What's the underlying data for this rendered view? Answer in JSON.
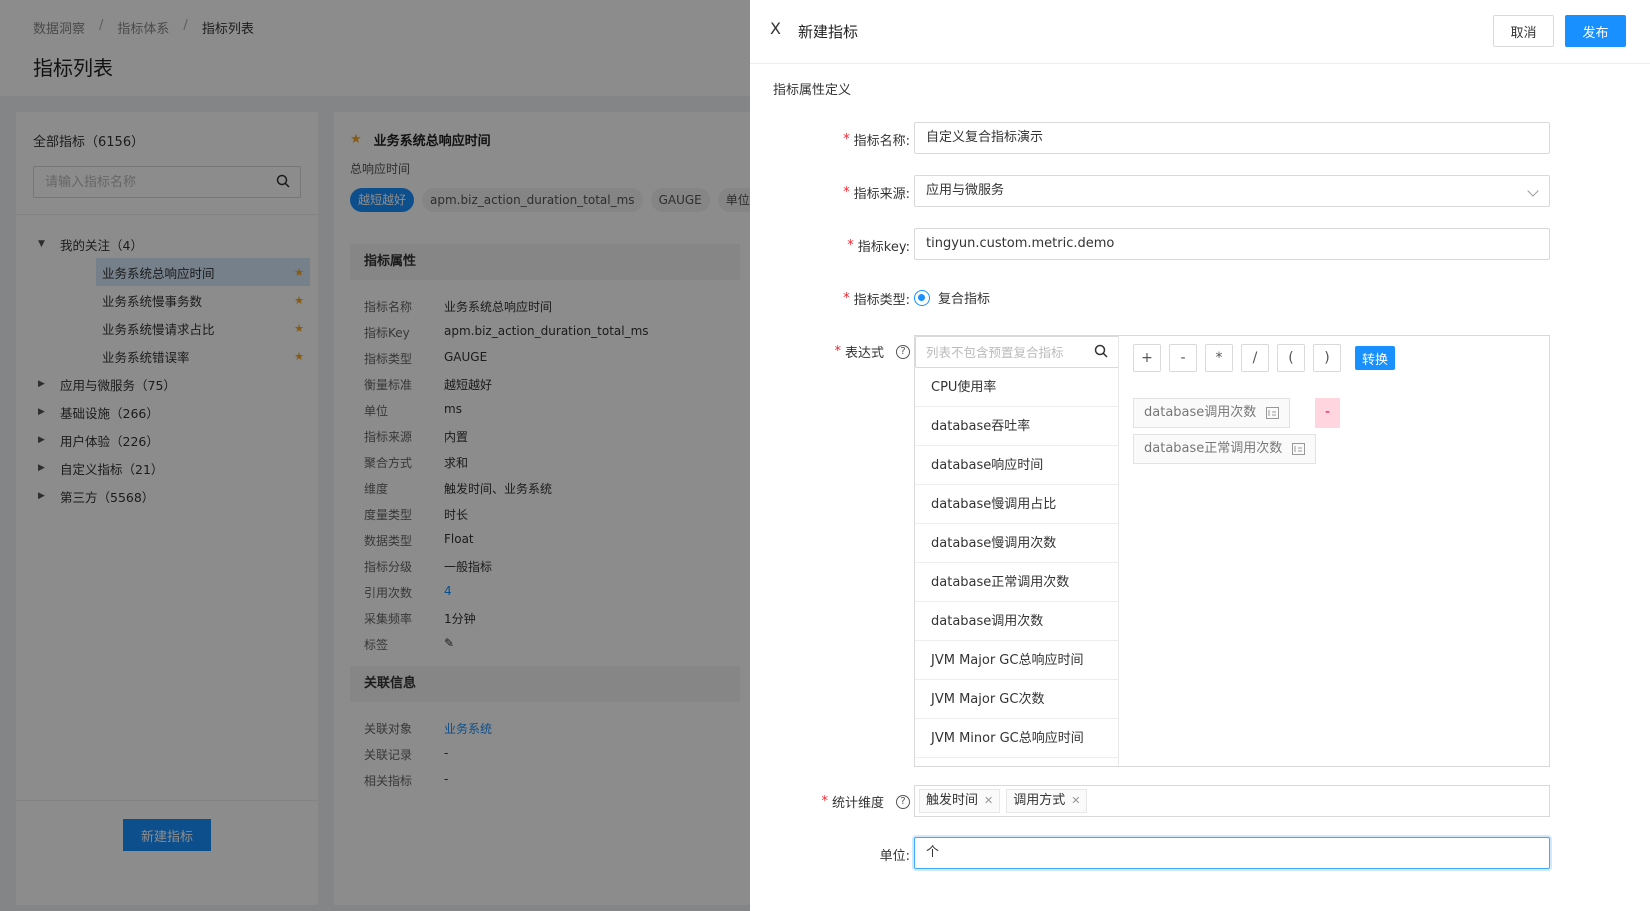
{
  "background": {
    "breadcrumb": [
      "数据洞察",
      "指标体系",
      "指标列表"
    ],
    "page_title": "指标列表",
    "left": {
      "total": "全部指标（6156）",
      "search_placeholder": "请输入指标名称",
      "groups": [
        {
          "label": "我的关注（4）",
          "expanded": true,
          "children": [
            "业务系统总响应时间",
            "业务系统慢事务数",
            "业务系统慢请求占比",
            "业务系统错误率"
          ]
        },
        {
          "label": "应用与微服务（75）"
        },
        {
          "label": "基础设施（266）"
        },
        {
          "label": "用户体验（226）"
        },
        {
          "label": "自定义指标（21）"
        },
        {
          "label": "第三方（5568）"
        }
      ],
      "new_button": "新建指标"
    },
    "mid": {
      "title": "业务系统总响应时间",
      "subtitle": "总响应时间",
      "tags": [
        "越短越好",
        "apm.biz_action_duration_total_ms",
        "GAUGE",
        "单位：ms"
      ],
      "attr_section": "指标属性",
      "attrs": [
        {
          "k": "指标名称",
          "v": "业务系统总响应时间"
        },
        {
          "k": "指标Key",
          "v": "apm.biz_action_duration_total_ms"
        },
        {
          "k": "指标类型",
          "v": "GAUGE"
        },
        {
          "k": "衡量标准",
          "v": "越短越好"
        },
        {
          "k": "单位",
          "v": "ms"
        },
        {
          "k": "指标来源",
          "v": "内置"
        },
        {
          "k": "聚合方式",
          "v": "求和"
        },
        {
          "k": "维度",
          "v": "触发时间、业务系统"
        },
        {
          "k": "度量类型",
          "v": "时长"
        },
        {
          "k": "数据类型",
          "v": "Float"
        },
        {
          "k": "指标分级",
          "v": "一般指标"
        },
        {
          "k": "引用次数",
          "v": "4"
        },
        {
          "k": "采集频率",
          "v": "1分钟"
        },
        {
          "k": "标签",
          "v": "✎"
        }
      ],
      "rel_section": "关联信息",
      "rels": [
        {
          "k": "关联对象",
          "v": "业务系统"
        },
        {
          "k": "关联记录",
          "v": "-"
        },
        {
          "k": "相关指标",
          "v": "-"
        }
      ]
    }
  },
  "drawer": {
    "close": "X",
    "title": "新建指标",
    "cancel": "取消",
    "publish": "发布",
    "section": "指标属性定义",
    "fields": {
      "name": {
        "label": "指标名称:",
        "value": "自定义复合指标演示"
      },
      "source": {
        "label": "指标来源:",
        "value": "应用与微服务"
      },
      "key": {
        "label": "指标key:",
        "value": "tingyun.custom.metric.demo"
      },
      "type": {
        "label": "指标类型:",
        "value": "复合指标"
      },
      "expr": {
        "label": "表达式",
        "search_placeholder": "列表不包含预置复合指标"
      },
      "dims": {
        "label": "统计维度"
      },
      "unit": {
        "label": "单位:",
        "value": "个"
      }
    },
    "metric_list": [
      "CPU使用率",
      "database吞吐率",
      "database响应时间",
      "database慢调用占比",
      "database慢调用次数",
      "database正常调用次数",
      "database调用次数",
      "JVM Major GC总响应时间",
      "JVM Major GC次数",
      "JVM Minor GC总响应时间"
    ],
    "operators": [
      "+",
      "-",
      "*",
      "/",
      "(",
      ")"
    ],
    "convert": "转换",
    "expression_chips": [
      "database调用次数",
      "database正常调用次数"
    ],
    "expression_operator": "-",
    "dimension_tags": [
      "触发时间",
      "调用方式"
    ],
    "required_mark": "*",
    "help_mark": "?"
  }
}
